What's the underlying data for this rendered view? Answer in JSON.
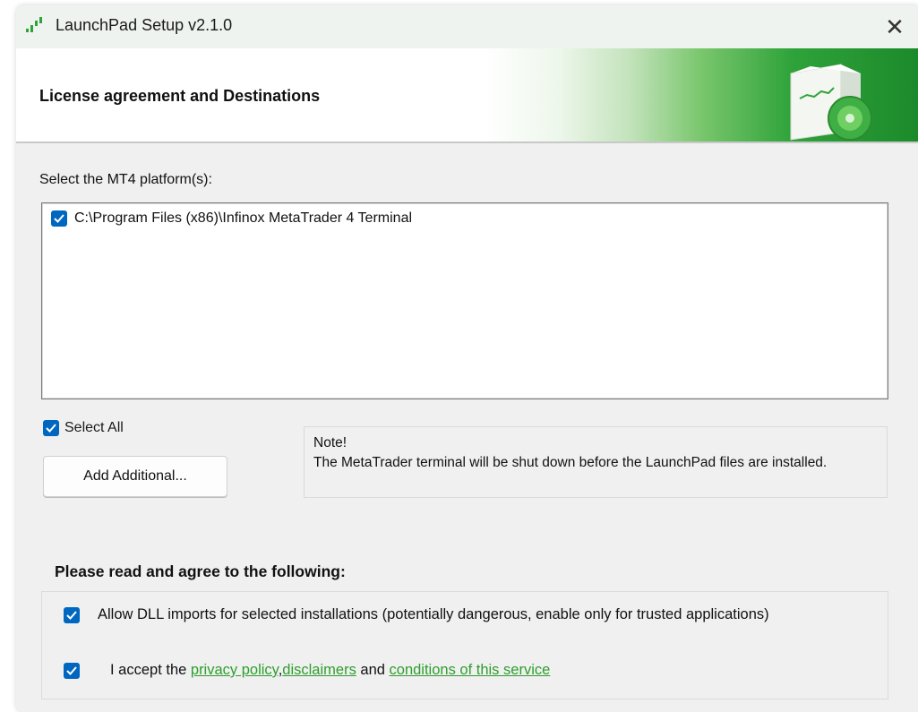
{
  "window": {
    "title": "LaunchPad Setup v2.1.0",
    "close_glyph": "✕",
    "accent_color": "#0067c0",
    "link_color": "#2e9e2e"
  },
  "banner": {
    "title": "License agreement and Destinations"
  },
  "platforms": {
    "label": "Select the MT4 platform(s):",
    "items": [
      {
        "path": "C:\\Program Files (x86)\\Infinox MetaTrader 4 Terminal",
        "checked": true
      }
    ],
    "select_all_label": "Select All",
    "select_all_checked": true,
    "add_button_label": "Add Additional..."
  },
  "note": {
    "title": "Note!",
    "text": "The MetaTrader terminal will be shut down before the LaunchPad files are installed."
  },
  "agreement": {
    "heading": "Please read and agree to the following:",
    "dll_label": "Allow DLL imports for selected installations (potentially dangerous, enable only for trusted applications)",
    "dll_checked": true,
    "accept_checked": true,
    "accept_prefix": "I accept the ",
    "privacy_link": "privacy policy",
    "separator": ",",
    "disclaimers_link": "disclaimers",
    "and_text": " and ",
    "conditions_link": "conditions of this service"
  }
}
